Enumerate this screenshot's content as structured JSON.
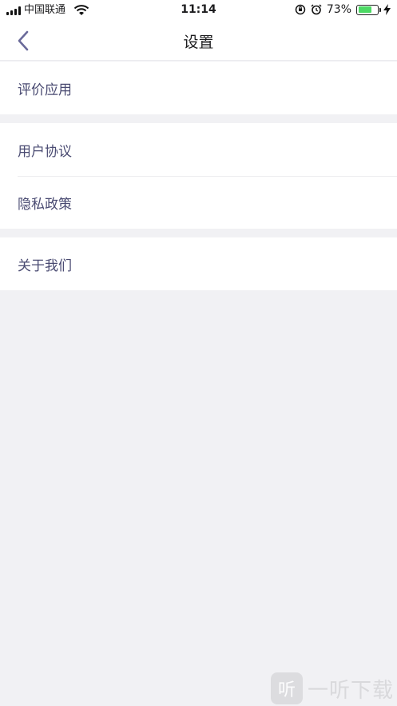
{
  "status_bar": {
    "carrier": "中国联通",
    "time": "11:14",
    "battery_percent": "73%",
    "battery_level": 0.73,
    "icons": [
      "signal-icon",
      "wifi-icon",
      "orientation-lock-icon",
      "alarm-icon",
      "battery-icon",
      "charging-icon"
    ]
  },
  "nav": {
    "title": "设置",
    "back_icon": "chevron-left-icon"
  },
  "groups": [
    {
      "items": [
        {
          "label": "评价应用"
        }
      ]
    },
    {
      "items": [
        {
          "label": "用户协议"
        },
        {
          "label": "隐私政策"
        }
      ]
    },
    {
      "items": [
        {
          "label": "关于我们"
        }
      ]
    }
  ],
  "watermark": {
    "logo_text": "听",
    "text": "一听下载"
  },
  "colors": {
    "background": "#f1f1f4",
    "row_text": "#4a4b72",
    "back_chevron": "#6a6a9a",
    "battery_fill": "#4cd964"
  }
}
